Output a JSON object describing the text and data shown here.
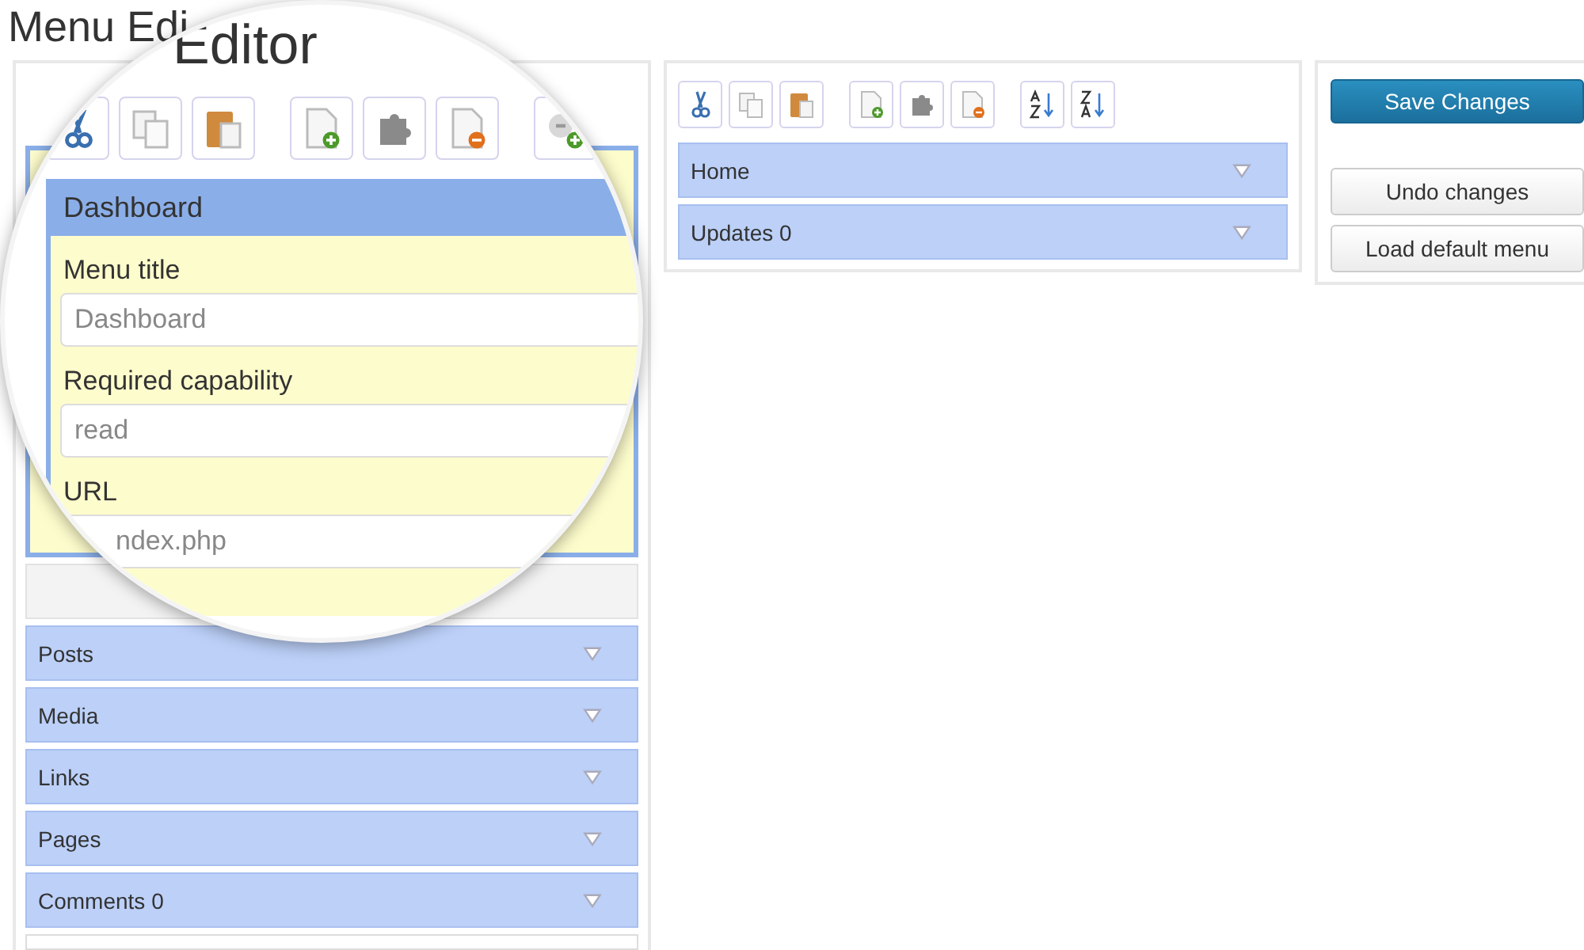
{
  "title": "Menu Edi",
  "left_menu": {
    "items": [
      {
        "expanded": true
      },
      {
        "label": "Posts",
        "expanded": false
      },
      {
        "label": "Media",
        "expanded": false
      },
      {
        "label": "Links",
        "expanded": false
      },
      {
        "label": "Pages",
        "expanded": false
      },
      {
        "label": "Comments 0",
        "expanded": false
      }
    ]
  },
  "middle_panel": {
    "toolbar": [
      {
        "kind": "cut"
      },
      {
        "kind": "copy"
      },
      {
        "kind": "paste"
      },
      {
        "kind": "gap"
      },
      {
        "kind": "new"
      },
      {
        "kind": "plugin"
      },
      {
        "kind": "delete"
      },
      {
        "kind": "gap"
      },
      {
        "kind": "sort-az"
      },
      {
        "kind": "sort-za"
      }
    ],
    "items": [
      {
        "label": "Home",
        "expanded": false
      },
      {
        "label": "Updates 0",
        "expanded": false
      }
    ]
  },
  "buttons": [
    {
      "label": "Save Changes",
      "kind": "primary"
    },
    {
      "label": "Undo changes",
      "kind": "secondary"
    },
    {
      "label": "Load default menu",
      "kind": "secondary"
    }
  ],
  "magnifier": {
    "title": "Editor",
    "toolbar": [
      {
        "kind": "cut"
      },
      {
        "kind": "copy"
      },
      {
        "kind": "paste"
      },
      {
        "kind": "gap"
      },
      {
        "kind": "new"
      },
      {
        "kind": "plugin"
      },
      {
        "kind": "delete"
      },
      {
        "kind": "gap"
      },
      {
        "kind": "separator"
      }
    ],
    "item": {
      "label": "Dashboard",
      "expanded": true
    },
    "fields": [
      {
        "label": "Menu title",
        "value": "Dashboard"
      },
      {
        "label": "Required capability",
        "value": "read"
      },
      {
        "label": "URL",
        "value": "ndex.php",
        "kind": "partial"
      }
    ]
  }
}
